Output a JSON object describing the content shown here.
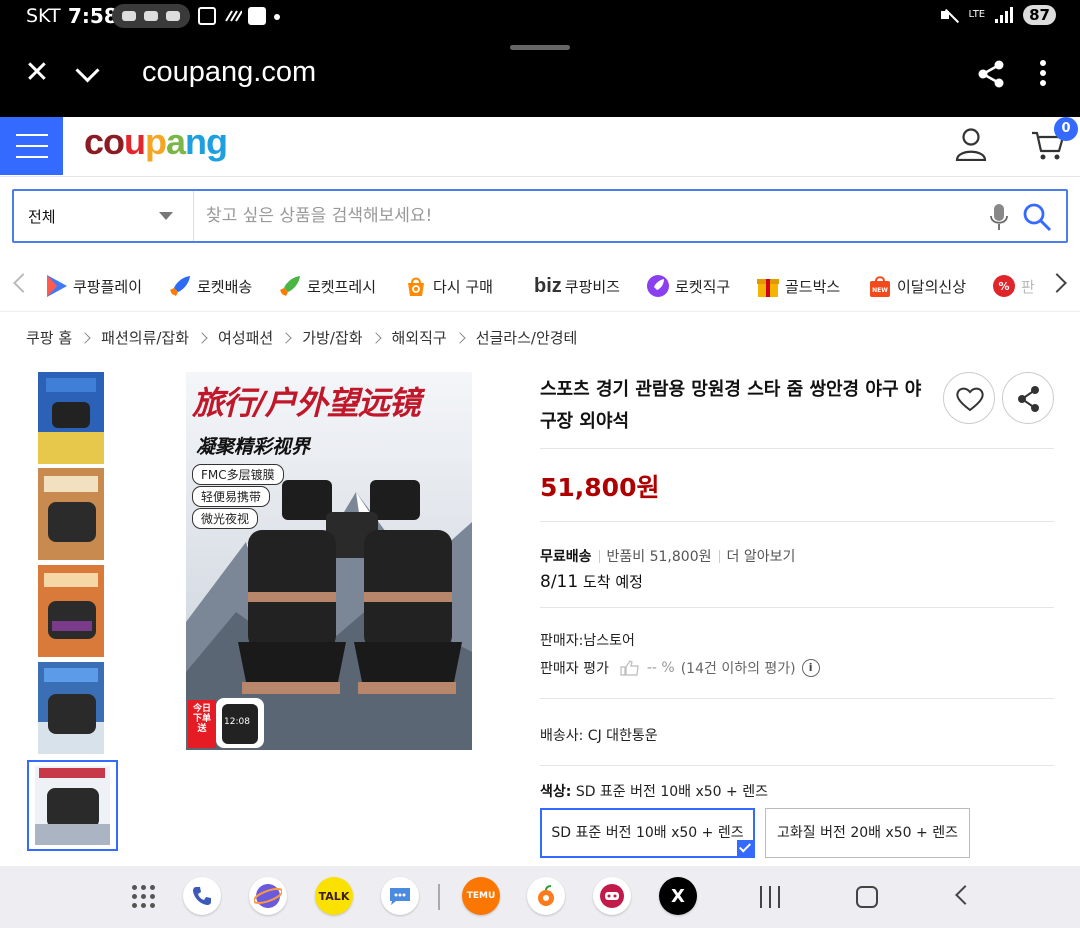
{
  "status_bar": {
    "carrier": "SKT",
    "time": "7:58",
    "network": "LTE",
    "battery": "87"
  },
  "browser": {
    "url": "coupang.com"
  },
  "header": {
    "logo": "coupang",
    "cart_count": "0"
  },
  "search": {
    "category": "전체",
    "placeholder": "찾고 싶은 상품을 검색해보세요!"
  },
  "categories": [
    {
      "label": "쿠팡플레이",
      "icon": "play-icon",
      "color": "#3f7af6"
    },
    {
      "label": "로켓배송",
      "icon": "rocket-icon",
      "color": "#2d6bf5"
    },
    {
      "label": "로켓프레시",
      "icon": "rocket-fresh-icon",
      "color": "#4bb543"
    },
    {
      "label": "다시 구매",
      "icon": "rebuy-icon",
      "color": "#ff8a00"
    },
    {
      "label": "쿠팡비즈",
      "prefix": "biz",
      "icon": "biz-icon",
      "color": "#333333"
    },
    {
      "label": "로켓직구",
      "icon": "rocket-global-icon",
      "color": "#8a3ff0"
    },
    {
      "label": "골드박스",
      "icon": "goldbox-icon",
      "color": "#f5b400"
    },
    {
      "label": "이달의신상",
      "icon": "new-icon",
      "color": "#f24a1c"
    },
    {
      "label": "판",
      "icon": "discount-icon",
      "color": "#e0252a"
    }
  ],
  "breadcrumb": [
    "쿠팡 홈",
    "패션의류/잡화",
    "여성패션",
    "가방/잡화",
    "해외직구",
    "선글라스/안경테"
  ],
  "main_image": {
    "title": "旅行/户外望远镜",
    "subtitle": "凝聚精彩视界",
    "tags": [
      "FMC多层镀膜",
      "轻便易携带",
      "微光夜视"
    ],
    "promo": "今日下单送",
    "watch": "12:08"
  },
  "product": {
    "title": "스포츠 경기 관람용 망원경 스타 줌 쌍안경 야구 야구장 외야석",
    "price": "51,800원",
    "shipping": {
      "free": "무료배송",
      "return_fee": "반품비 51,800원",
      "more": "더 알아보기"
    },
    "arrival": {
      "date": "8/11",
      "label": "도착 예정"
    },
    "seller": "판매자:남스토어",
    "seller_rating": {
      "label": "판매자 평가",
      "value": "-- %",
      "count": "(14건 이하의 평가)",
      "info": "i"
    },
    "carrier": "배송사:  CJ 대한통운",
    "color": {
      "label": "색상:",
      "value": "SD 표준 버전 10배 x50 + 렌즈"
    },
    "options": [
      "SD 표준 버전 10배 x50 + 렌즈",
      "고화질 버전 20배 x50 + 렌즈"
    ]
  },
  "nav_apps": [
    {
      "name": "phone-app-icon",
      "color": "#ffffff"
    },
    {
      "name": "browser-app-icon",
      "color": "#ffffff"
    },
    {
      "name": "kakaotalk-app-icon",
      "text": "TALK",
      "color": "#fae100"
    },
    {
      "name": "messages-app-icon",
      "color": "#ffffff"
    },
    {
      "name": "temu-app-icon",
      "text": "TEMU",
      "color": "#fb7701"
    },
    {
      "name": "fruit-app-icon",
      "color": "#ffffff"
    },
    {
      "name": "game-app-icon",
      "color": "#ffffff"
    },
    {
      "name": "x-app-icon",
      "text": "X",
      "color": "#000000"
    }
  ]
}
